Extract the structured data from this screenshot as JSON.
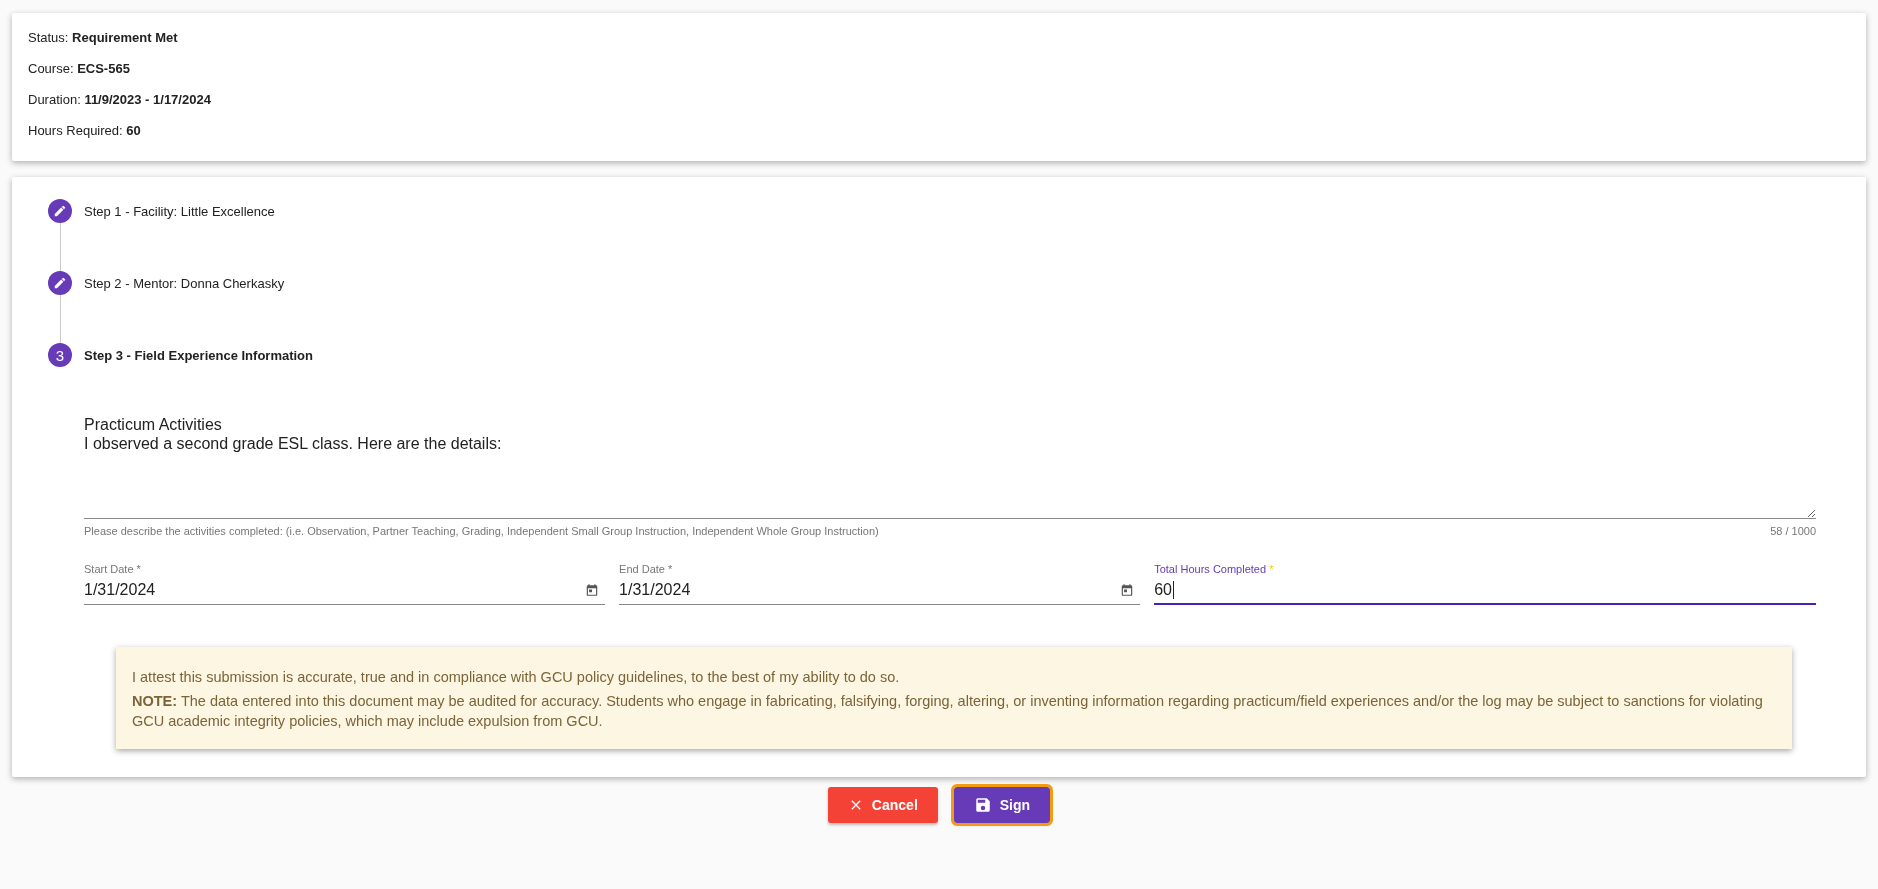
{
  "summary": [
    {
      "label": "Status:",
      "value": "Requirement Met"
    },
    {
      "label": "Course:",
      "value": "ECS-565"
    },
    {
      "label": "Duration:",
      "value": "11/9/2023 - 1/17/2024"
    },
    {
      "label": "Hours Required:",
      "value": "60"
    }
  ],
  "steps": [
    {
      "kind": "completed",
      "title": "Step 1 - Facility: Little Excellence"
    },
    {
      "kind": "completed",
      "title": "Step 2 - Mentor: Donna Cherkasky"
    },
    {
      "kind": "active",
      "number": "3",
      "title": "Step 3 - Field Experience Information"
    }
  ],
  "activities": {
    "value": "Practicum Activities\nI observed a second grade ESL class. Here are the details:",
    "hint": "Please describe the activities completed: (i.e. Observation, Partner Teaching, Grading, Independent Small Group Instruction, Independent Whole Group Instruction)",
    "counter": "58 / 1000"
  },
  "fields": [
    {
      "kind": "date",
      "label": "Start Date",
      "required_mark": "*",
      "value": "1/31/2024",
      "focused": false
    },
    {
      "kind": "date",
      "label": "End Date",
      "required_mark": "*",
      "value": "1/31/2024",
      "focused": false
    },
    {
      "kind": "number",
      "label": "Total Hours Completed",
      "required_mark": "*",
      "value": "60",
      "focused": true
    }
  ],
  "notice": {
    "text": "I attest this submission is accurate, true and in compliance with GCU policy guidelines, to the best of my ability to do so.",
    "note": "**NOTE:** The data entered into this document may be audited for accuracy. Students who engage in fabricating, falsifying, forging, altering, or inventing information regarding practicum/field experiences and/or the log may be subject to sanctions for violating GCU academic integrity policies, which may include expulsion from GCU."
  },
  "buttons": [
    {
      "kind": "cancel",
      "label": "Cancel",
      "focused": false
    },
    {
      "kind": "sign",
      "label": "Sign",
      "focused": true
    }
  ]
}
